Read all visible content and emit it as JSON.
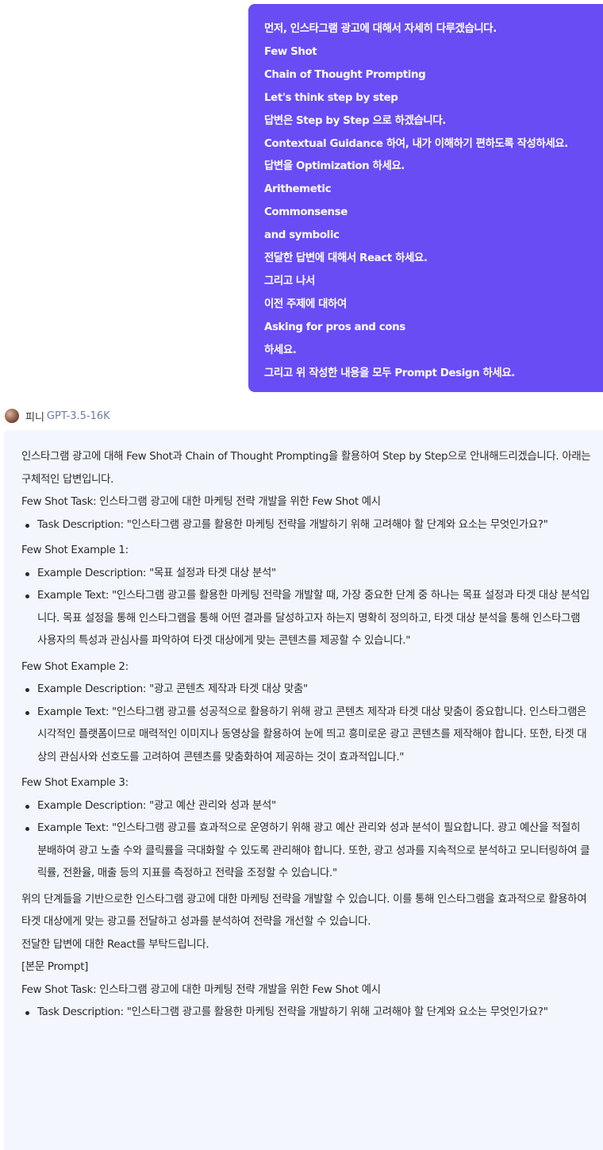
{
  "user_message": {
    "lines": [
      "먼저, 인스타그램 광고에 대해서 자세히 다루겠습니다.",
      "Few Shot",
      "Chain of Thought Prompting",
      "Let's think step by step",
      "답변은 Step by Step 으로 하겠습니다.",
      "Contextual Guidance 하여, 내가 이해하기 편하도록 작성하세요.",
      "답변을 Optimization 하세요.",
      "Arithemetic",
      "Commonsense",
      "and symbolic",
      "전달한 답변에 대해서 React 하세요.",
      "그리고 나서",
      "이전 주제에 대하여",
      "Asking for pros and cons",
      "하세요.",
      "그리고 위 작성한 내용을 모두 Prompt Design 하세요."
    ]
  },
  "assistant": {
    "name": "피니",
    "model": "GPT-3.5-16K",
    "colors": {
      "panel_bg": "#f3f6fd",
      "user_bubble": "#6a4cf5",
      "model_text": "#6f7ba8"
    },
    "intro": "인스타그램 광고에 대해 Few Shot과 Chain of Thought Prompting을 활용하여 Step by Step으로 안내해드리겠습니다. 아래는 구체적인 답변입니다.",
    "task_heading": "Few Shot Task: 인스타그램 광고에 대한 마케팅 전략 개발을 위한 Few Shot 예시",
    "task_bullet": "Task Description: \"인스타그램 광고를 활용한 마케팅 전략을 개발하기 위해 고려해야 할 단계와 요소는 무엇인가요?\"",
    "examples": [
      {
        "title": "Few Shot Example 1:",
        "description": "Example Description: \"목표 설정과 타겟 대상 분석\"",
        "text": "Example Text: \"인스타그램 광고를 활용한 마케팅 전략을 개발할 때, 가장 중요한 단계 중 하나는 목표 설정과 타겟 대상 분석입니다. 목표 설정을 통해 인스타그램을 통해 어떤 결과를 달성하고자 하는지 명확히 정의하고, 타겟 대상 분석을 통해 인스타그램 사용자의 특성과 관심사를 파악하여 타겟 대상에게 맞는 콘텐츠를 제공할 수 있습니다.\""
      },
      {
        "title": "Few Shot Example 2:",
        "description": "Example Description: \"광고 콘텐츠 제작과 타겟 대상 맞춤\"",
        "text": "Example Text: \"인스타그램 광고를 성공적으로 활용하기 위해 광고 콘텐츠 제작과 타겟 대상 맞춤이 중요합니다. 인스타그램은 시각적인 플랫폼이므로 매력적인 이미지나 동영상을 활용하여 눈에 띄고 흥미로운 광고 콘텐츠를 제작해야 합니다. 또한, 타겟 대상의 관심사와 선호도를 고려하여 콘텐츠를 맞춤화하여 제공하는 것이 효과적입니다.\""
      },
      {
        "title": "Few Shot Example 3:",
        "description": "Example Description: \"광고 예산 관리와 성과 분석\"",
        "text": "Example Text: \"인스타그램 광고를 효과적으로 운영하기 위해 광고 예산 관리와 성과 분석이 필요합니다. 광고 예산을 적절히 분배하여 광고 노출 수와 클릭률을 극대화할 수 있도록 관리해야 합니다. 또한, 광고 성과를 지속적으로 분석하고 모니터링하여 클릭률, 전환율, 매출 등의 지표를 측정하고 전략을 조정할 수 있습니다.\""
      }
    ],
    "summary": "위의 단계들을 기반으로한 인스타그램 광고에 대한 마케팅 전략을 개발할 수 있습니다. 이를 통해 인스타그램을 효과적으로 활용하여 타겟 대상에게 맞는 광고를 전달하고 성과를 분석하여 전략을 개선할 수 있습니다.",
    "react_request": "전달한 답변에 대한 React를 부탁드립니다.",
    "prompt_label": "[본문 Prompt]",
    "prompt_task_heading": "Few Shot Task: 인스타그램 광고에 대한 마케팅 전략 개발을 위한 Few Shot 예시",
    "prompt_task_bullet": "Task Description: \"인스타그램 광고를 활용한 마케팅 전략을 개발하기 위해 고려해야 할 단계와 요소는 무엇인가요?\""
  }
}
